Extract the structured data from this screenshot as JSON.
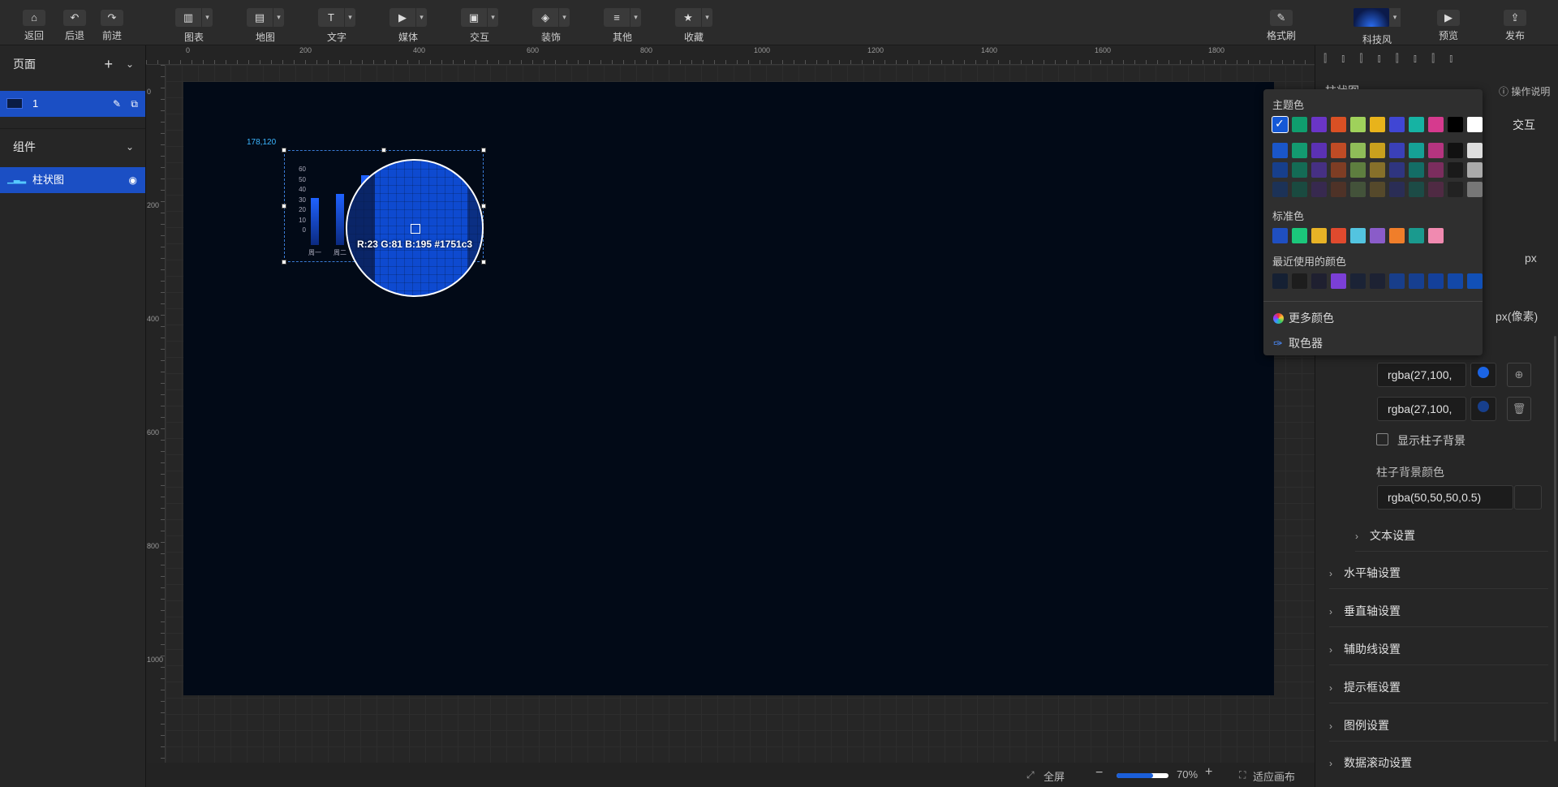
{
  "toolbar": {
    "back": "返回",
    "undo": "后退",
    "redo": "前进",
    "groups": [
      "图表",
      "地图",
      "文字",
      "媒体",
      "交互",
      "装饰",
      "其他",
      "收藏"
    ],
    "format_brush": "格式刷",
    "theme": "科技风",
    "preview": "预览",
    "publish": "发布"
  },
  "left": {
    "pages_title": "页面",
    "page_item": "1",
    "components_title": "组件",
    "component_item": "柱状图"
  },
  "ruler": {
    "h_ticks": [
      "0",
      "200",
      "400",
      "600",
      "800",
      "1000",
      "1200",
      "1400",
      "1600",
      "1800"
    ],
    "v_ticks": [
      "0",
      "200",
      "400",
      "600",
      "800",
      "1000"
    ]
  },
  "canvas": {
    "coords": "178,120",
    "chart_y_ticks": [
      "60",
      "50",
      "40",
      "30",
      "20",
      "10",
      "0"
    ],
    "chart_x_labels": [
      "周一",
      "周二"
    ],
    "magnifier_text": "R:23 G:81 B:195 #1751c3"
  },
  "statusbar": {
    "fullscreen": "全屏",
    "zoom": "70%",
    "fit": "适应画布",
    "zoom_fraction": 0.7
  },
  "right": {
    "title": "柱状图",
    "help": "操作说明",
    "tab_interact": "交互",
    "px_label": "px",
    "px_label2": "px(像素)",
    "color1": "rgba(27,100,",
    "color2": "rgba(27,100,",
    "show_bg": "显示柱子背景",
    "bg_color_label": "柱子背景颜色",
    "bg_color": "rgba(50,50,50,0.5)",
    "text_settings": "文本设置",
    "sections": [
      "水平轴设置",
      "垂直轴设置",
      "辅助线设置",
      "提示框设置",
      "图例设置",
      "数据滚动设置"
    ]
  },
  "popup": {
    "theme_title": "主题色",
    "standard_title": "标准色",
    "recent_title": "最近使用的颜色",
    "more_colors": "更多颜色",
    "eyedropper": "取色器",
    "theme_row": [
      "#1458d6",
      "#0f9e6e",
      "#6a35c7",
      "#d95024",
      "#9fd15b",
      "#e8b31b",
      "#4046d4",
      "#16b3a3",
      "#d63a8e",
      "#000000",
      "#ffffff"
    ],
    "shade1": [
      "#1a56c9",
      "#139a70",
      "#5b31b4",
      "#bf4b25",
      "#8fbc58",
      "#c9a01d",
      "#3a40b8",
      "#15a195",
      "#b5347f",
      "#111111",
      "#dddddd"
    ],
    "shade2": [
      "#173f8c",
      "#146b55",
      "#463083",
      "#7e3d24",
      "#5e7e3f",
      "#86702a",
      "#2f3580",
      "#136d66",
      "#7b2d5e",
      "#1a1a1a",
      "#aaaaaa"
    ],
    "shade3": [
      "#1c3257",
      "#1a4a40",
      "#37294f",
      "#4e3227",
      "#43523a",
      "#55492b",
      "#2a2d55",
      "#1c4b46",
      "#4f2a43",
      "#222222",
      "#777777"
    ],
    "standard": [
      "#1f4fc1",
      "#1bc77b",
      "#e8b326",
      "#e04a2e",
      "#53c4e0",
      "#8a5cc9",
      "#f07e2a",
      "#1a9a8e",
      "#f08ab0"
    ],
    "recent": [
      "#152033",
      "#1d1d1d",
      "#1f2030",
      "#7b3fd6",
      "#1b2336",
      "#1d2233",
      "#183e8a",
      "#163f90",
      "#14409a",
      "#1348a8",
      "#1150b7"
    ]
  }
}
